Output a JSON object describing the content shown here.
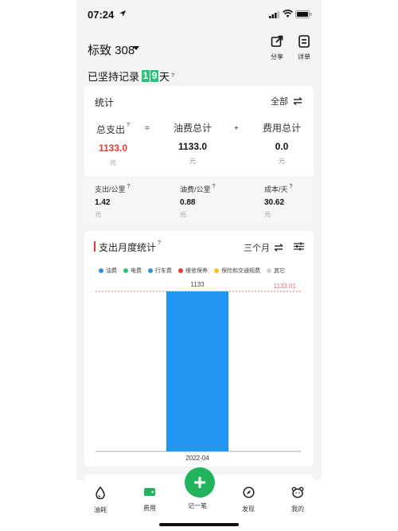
{
  "status_bar": {
    "time": "07:24"
  },
  "header": {
    "car_name": "标致 308",
    "share_label": "分享",
    "detail_label": "详单",
    "streak_prefix": "已坚持记录",
    "streak_digits": [
      "1",
      "9"
    ],
    "streak_suffix": "天",
    "help_mark": "?"
  },
  "stats": {
    "title": "统计",
    "filter_label": "全部",
    "total": {
      "label": "总支出",
      "value": "1133.0",
      "unit": "元"
    },
    "op_equals": "=",
    "fuel": {
      "label": "油费总计",
      "value": "1133.0",
      "unit": "元"
    },
    "op_plus": "+",
    "expense": {
      "label": "费用总计",
      "value": "0.0",
      "unit": "元"
    },
    "per_km": {
      "label": "支出/公里",
      "value": "1.42",
      "unit": "元"
    },
    "fuel_per_km": {
      "label": "油费/公里",
      "value": "0.88",
      "unit": "元"
    },
    "per_day": {
      "label": "成本/天",
      "value": "30.62",
      "unit": "元"
    }
  },
  "monthly": {
    "title": "支出月度统计",
    "range_label": "三个月",
    "legend": [
      {
        "name": "油费",
        "color": "#2f8fd8"
      },
      {
        "name": "电费",
        "color": "#2ec27e"
      },
      {
        "name": "行车费",
        "color": "#2f8fd8"
      },
      {
        "name": "维修保养",
        "color": "#e53935"
      },
      {
        "name": "保险和交通规费",
        "color": "#f5c518"
      },
      {
        "name": "其它",
        "color": "#cfcfcf"
      }
    ],
    "bar_color": "#2196f3",
    "ref_color": "#e57373"
  },
  "chart_data": {
    "type": "bar",
    "categories": [
      "2022-04"
    ],
    "values": [
      1133
    ],
    "value_labels": [
      "1133"
    ],
    "reference_line": {
      "value": 1133.01,
      "label": "1133.01"
    },
    "ylim": [
      0,
      1133.01
    ],
    "title": "支出月度统计",
    "xlabel": "",
    "ylabel": ""
  },
  "tabbar": {
    "items": [
      {
        "label": "油耗",
        "icon": "fuel-drop-icon"
      },
      {
        "label": "费用",
        "icon": "wallet-icon"
      },
      {
        "label": "记一笔",
        "icon": "plus-icon"
      },
      {
        "label": "发现",
        "icon": "compass-icon"
      },
      {
        "label": "我的",
        "icon": "bear-icon"
      }
    ],
    "accent": "#22b45c"
  }
}
